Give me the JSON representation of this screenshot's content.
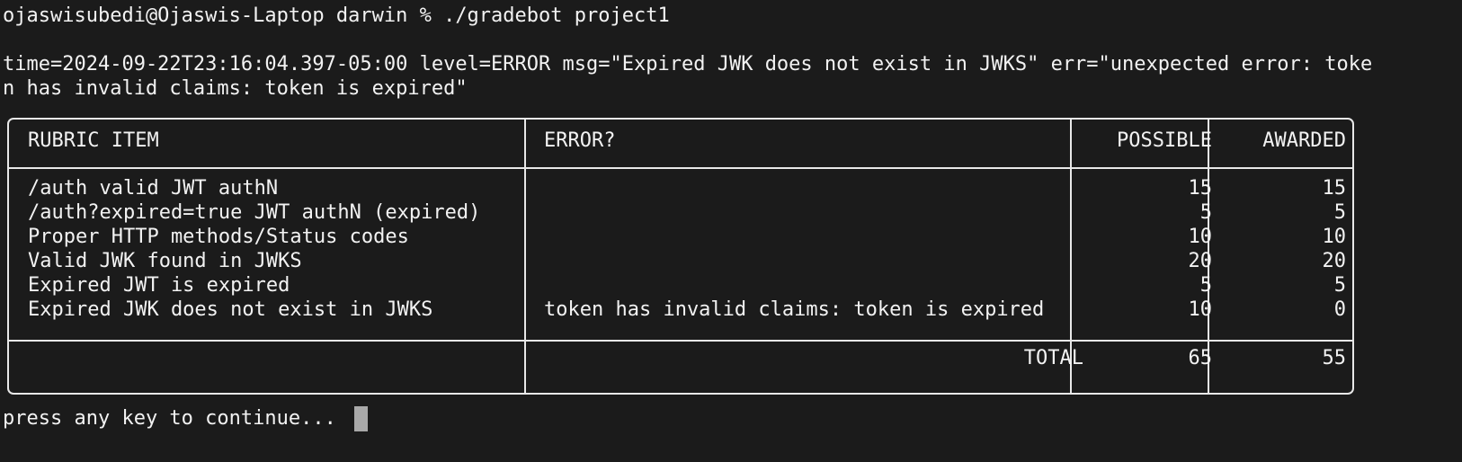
{
  "terminal": {
    "partial_line": "· · · · · · ·",
    "prompt_line": "ojaswisubedi@Ojaswis-Laptop darwin % ./gradebot project1",
    "log_line_1": "time=2024-09-22T23:16:04.397-05:00 level=ERROR msg=\"Expired JWK does not exist in JWKS\" err=\"unexpected error: toke",
    "log_line_2": "n has invalid claims: token is expired\"",
    "continue_prompt": "press any key to continue..."
  },
  "table": {
    "headers": {
      "rubric_item": "RUBRIC ITEM",
      "error": "ERROR?",
      "possible": "POSSIBLE",
      "awarded": "AWARDED"
    },
    "rows": [
      {
        "item": "/auth valid JWT authN",
        "error": "",
        "possible": "15",
        "awarded": "15"
      },
      {
        "item": "/auth?expired=true JWT authN (expired)",
        "error": "",
        "possible": "5",
        "awarded": "5"
      },
      {
        "item": "Proper HTTP methods/Status codes",
        "error": "",
        "possible": "10",
        "awarded": "10"
      },
      {
        "item": "Valid JWK found in JWKS",
        "error": "",
        "possible": "20",
        "awarded": "20"
      },
      {
        "item": "Expired JWT is expired",
        "error": "",
        "possible": "5",
        "awarded": "5"
      },
      {
        "item": "Expired JWK does not exist in JWKS",
        "error": "token has invalid claims: token is expired",
        "possible": "10",
        "awarded": "0"
      }
    ],
    "total": {
      "label": "TOTAL",
      "possible": "65",
      "awarded": "55"
    }
  },
  "colors": {
    "background": "#1b1b1b",
    "text": "#f2f2f2",
    "border": "#e8e8e8",
    "cursor": "#a9a9a9"
  }
}
